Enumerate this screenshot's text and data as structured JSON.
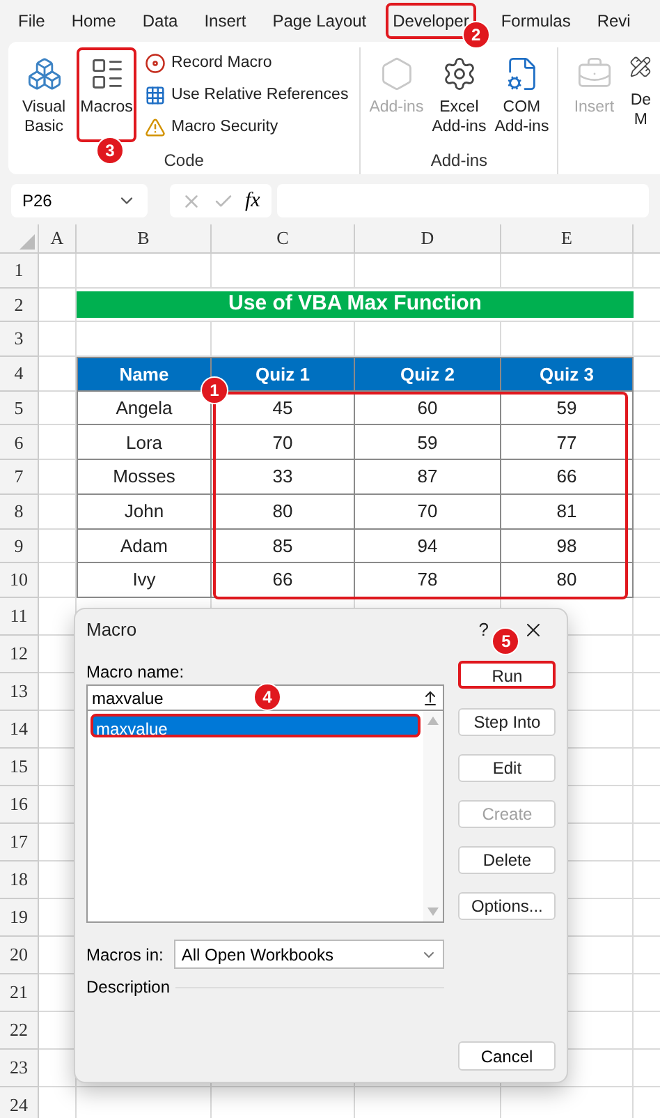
{
  "ribbon_tabs": [
    {
      "label": "File",
      "outlined": false
    },
    {
      "label": "Home",
      "outlined": false
    },
    {
      "label": "Data",
      "outlined": false
    },
    {
      "label": "Insert",
      "outlined": false
    },
    {
      "label": "Page Layout",
      "outlined": false
    },
    {
      "label": "Developer",
      "outlined": true,
      "badge": "2"
    },
    {
      "label": "Formulas",
      "outlined": false
    },
    {
      "label": "Revi",
      "outlined": false
    }
  ],
  "ribbon_groups": [
    {
      "name": "Code",
      "commands": [
        {
          "kind": "large",
          "label": "Visual Basic",
          "disabled": false,
          "outlined": false
        },
        {
          "kind": "large",
          "label": "Macros",
          "disabled": false,
          "outlined": true,
          "badge": "3"
        },
        {
          "kind": "small",
          "label": "Record Macro",
          "disabled": false,
          "outlined": false
        },
        {
          "kind": "small",
          "label": "Use Relative References",
          "disabled": false,
          "outlined": false
        },
        {
          "kind": "small",
          "label": "Macro Security",
          "disabled": false,
          "outlined": false
        }
      ]
    },
    {
      "name": "Add-ins",
      "commands": [
        {
          "kind": "large",
          "label": "Add-ins",
          "disabled": true,
          "outlined": false
        },
        {
          "kind": "large",
          "label": "Excel Add-ins",
          "disabled": false,
          "outlined": false
        },
        {
          "kind": "large",
          "label": "COM Add-ins",
          "disabled": false,
          "outlined": false
        }
      ]
    },
    {
      "commands": [
        {
          "kind": "large",
          "label": "Insert",
          "disabled": true,
          "outlined": false
        },
        {
          "kind": "narrow",
          "label": "De M",
          "disabled": false,
          "outlined": false
        }
      ]
    }
  ],
  "formula_bar": {
    "name_box": "P26",
    "fx": "fx"
  },
  "columns": [
    "A",
    "B",
    "C",
    "D",
    "E"
  ],
  "row_numbers": [
    "1",
    "2",
    "3",
    "4",
    "5",
    "6",
    "7",
    "8",
    "9",
    "10",
    "11",
    "12",
    "13",
    "14",
    "15",
    "16",
    "17",
    "18",
    "19",
    "20",
    "21",
    "22",
    "23",
    "24"
  ],
  "sheet_title": "Use of VBA Max Function",
  "table": {
    "columns": [
      "Name",
      "Quiz 1",
      "Quiz 2",
      "Quiz 3"
    ],
    "badge": "1",
    "rows": [
      [
        "Angela",
        "45",
        "60",
        "59"
      ],
      [
        "Lora",
        "70",
        "59",
        "77"
      ],
      [
        "Mosses",
        "33",
        "87",
        "66"
      ],
      [
        "John",
        "80",
        "70",
        "81"
      ],
      [
        "Adam",
        "85",
        "94",
        "98"
      ],
      [
        "Ivy",
        "66",
        "78",
        "80"
      ]
    ]
  },
  "dialog": {
    "title": "Macro",
    "help": "?",
    "name_label": "Macro name:",
    "name_value": "maxvalue",
    "macros": [
      {
        "label": "maxvalue",
        "selected": true,
        "outlined": true,
        "badge": "4"
      }
    ],
    "buttons": [
      {
        "label": "Run",
        "disabled": false,
        "outlined": true,
        "badge": "5"
      },
      {
        "label": "Step Into",
        "disabled": false,
        "outlined": false
      },
      {
        "label": "Edit",
        "disabled": false,
        "outlined": false
      },
      {
        "label": "Create",
        "disabled": true,
        "outlined": false
      },
      {
        "label": "Delete",
        "disabled": false,
        "outlined": false
      },
      {
        "label": "Options...",
        "disabled": false,
        "outlined": false
      }
    ],
    "macros_in_label": "Macros in:",
    "macros_in_value": "All Open Workbooks",
    "description_label": "Description",
    "cancel": "Cancel"
  }
}
